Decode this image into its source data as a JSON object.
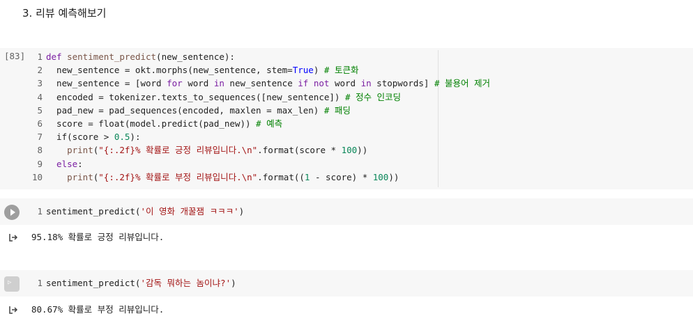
{
  "heading": "3. 리뷰 예측해보기",
  "cell1": {
    "exec_count": "[83]",
    "lines": [
      {
        "n": "1"
      },
      {
        "n": "2"
      },
      {
        "n": "3"
      },
      {
        "n": "4"
      },
      {
        "n": "5"
      },
      {
        "n": "6"
      },
      {
        "n": "7"
      },
      {
        "n": "8"
      },
      {
        "n": "9"
      },
      {
        "n": "10"
      }
    ],
    "code": {
      "l1_def": "def",
      "l1_fn": "sentiment_predict",
      "l1_rest": "(new_sentence):",
      "l2_a": "  new_sentence = okt.morphs(new_sentence, stem=",
      "l2_true": "True",
      "l2_b": ") ",
      "l2_cm": "# 토큰화",
      "l3_a": "  new_sentence = [word ",
      "l3_for": "for",
      "l3_b": " word ",
      "l3_in": "in",
      "l3_c": " new_sentence ",
      "l3_if": "if",
      "l3_d": " ",
      "l3_not": "not",
      "l3_e": " word ",
      "l3_in2": "in",
      "l3_f": " stopwords] ",
      "l3_cm": "# 불용어 제거",
      "l4_a": "  encoded = tokenizer.texts_to_sequences([new_sentence]) ",
      "l4_cm": "# 정수 인코딩",
      "l5_a": "  pad_new = pad_sequences(encoded, maxlen = max_len) ",
      "l5_cm": "# 패딩",
      "l6_a": "  score = float(model.predict(pad_new)) ",
      "l6_cm": "# 예측",
      "l7_a": "  if(score > ",
      "l7_num": "0.5",
      "l7_b": "):",
      "l8_a": "    ",
      "l8_print": "print",
      "l8_b": "(",
      "l8_str": "\"{:.2f}% 확률로 긍정 리뷰입니다.\\n\"",
      "l8_c": ".format(score * ",
      "l8_num": "100",
      "l8_d": "))",
      "l9_else": "  else",
      "l9_b": ":",
      "l10_a": "    ",
      "l10_print": "print",
      "l10_b": "(",
      "l10_str": "\"{:.2f}% 확률로 부정 리뷰입니다.\\n\"",
      "l10_c": ".format((",
      "l10_num1": "1",
      "l10_d": " - score) * ",
      "l10_num2": "100",
      "l10_e": "))"
    }
  },
  "cell2": {
    "line_no": "1",
    "code_a": "sentiment_predict(",
    "code_str": "'이 영화 개꿀잼 ㅋㅋㅋ'",
    "code_b": ")",
    "output": "95.18% 확률로 긍정 리뷰입니다."
  },
  "cell3": {
    "line_no": "1",
    "code_a": "sentiment_predict(",
    "code_str": "'감독 뭐하는 놈이냐?'",
    "code_b": ")",
    "output": "80.67% 확률로 부정 리뷰입니다."
  },
  "colors": {
    "cell_bg": "#f7f7f7",
    "keyword": "#7b1fa2",
    "comment": "#008000",
    "string": "#a31515",
    "number": "#098658"
  },
  "icons": {
    "run": "play-icon",
    "output": "output-arrow-icon"
  }
}
